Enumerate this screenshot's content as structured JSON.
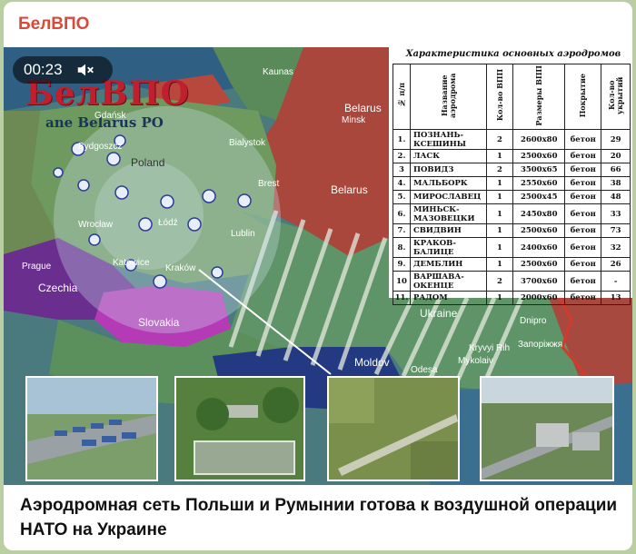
{
  "post": {
    "channel_name": "БелВПО",
    "caption": "Аэродромная сеть Польши и Румынии готова к воздушной операции НАТО на Украине"
  },
  "video": {
    "timestamp": "00:23",
    "mute_icon": "speaker-muted-icon"
  },
  "overlay": {
    "logo_text": "БелВПО",
    "logo_sub": "ane Belarus PO",
    "table_title": "Характеристика основных аэродромов",
    "columns": [
      "№ п/п",
      "Название аэродрома",
      "Кол-во ВПП",
      "Размеры ВПП",
      "Покрытие",
      "Кол-во укрытий"
    ],
    "rows": [
      {
        "n": "1.",
        "name": "ПОЗНАНЬ-КСЕШИНЫ",
        "vpp": "2",
        "size": "2600x80",
        "cover": "бетон",
        "shelters": "29"
      },
      {
        "n": "2.",
        "name": "ЛАСК",
        "vpp": "1",
        "size": "2500x60",
        "cover": "бетон",
        "shelters": "20"
      },
      {
        "n": "3",
        "name": "ПОВИДЗ",
        "vpp": "2",
        "size": "3500x65",
        "cover": "бетон",
        "shelters": "66"
      },
      {
        "n": "4.",
        "name": "МАЛЬБОРК",
        "vpp": "1",
        "size": "2550x60",
        "cover": "бетон",
        "shelters": "38"
      },
      {
        "n": "5.",
        "name": "МИРОСЛАВЕЦ",
        "vpp": "1",
        "size": "2500x45",
        "cover": "бетон",
        "shelters": "48"
      },
      {
        "n": "6.",
        "name": "МИНЬСК-МАЗОВЕЦКИ",
        "vpp": "1",
        "size": "2450x80",
        "cover": "бетон",
        "shelters": "33"
      },
      {
        "n": "7.",
        "name": "СВИДВИН",
        "vpp": "1",
        "size": "2500x60",
        "cover": "бетон",
        "shelters": "73"
      },
      {
        "n": "8.",
        "name": "КРАКОВ-БАЛИЦЕ",
        "vpp": "1",
        "size": "2400x60",
        "cover": "бетон",
        "shelters": "32"
      },
      {
        "n": "9.",
        "name": "ДЕМБЛИН",
        "vpp": "1",
        "size": "2500x60",
        "cover": "бетон",
        "shelters": "26"
      },
      {
        "n": "10",
        "name": "ВАРШАВА-ОКЕНЦЕ",
        "vpp": "2",
        "size": "3700x60",
        "cover": "бетон",
        "shelters": "-"
      },
      {
        "n": "11.",
        "name": "РАДОМ",
        "vpp": "1",
        "size": "2000x60",
        "cover": "бетон",
        "shelters": "13"
      }
    ],
    "map_labels": {
      "poland": "Poland",
      "belarus1": "Belarus",
      "belarus2": "Belarus",
      "kaunas": "Kaunas",
      "minsk": "Minsk",
      "czechia": "Czechia",
      "prague": "Prague",
      "slovakia": "Slovakia",
      "ukraine": "Ukraine",
      "moldova": "Moldov",
      "bialystok": "Bialystok",
      "gdansk": "Gdańsk",
      "bydgoszcz": "Bydgoszcz",
      "lodz": "Łódź",
      "wroclaw": "Wrocław",
      "katowice": "Katowice",
      "krakow": "Kraków",
      "lublin": "Lublin",
      "brest": "Brest",
      "dnipro": "Dnipro",
      "kryvyi_rih": "Kryvyi Rih",
      "zaporizhzhia": "Запоріжжя",
      "mykolaiv": "Mykolaiv",
      "odesa": "Odesa"
    }
  }
}
